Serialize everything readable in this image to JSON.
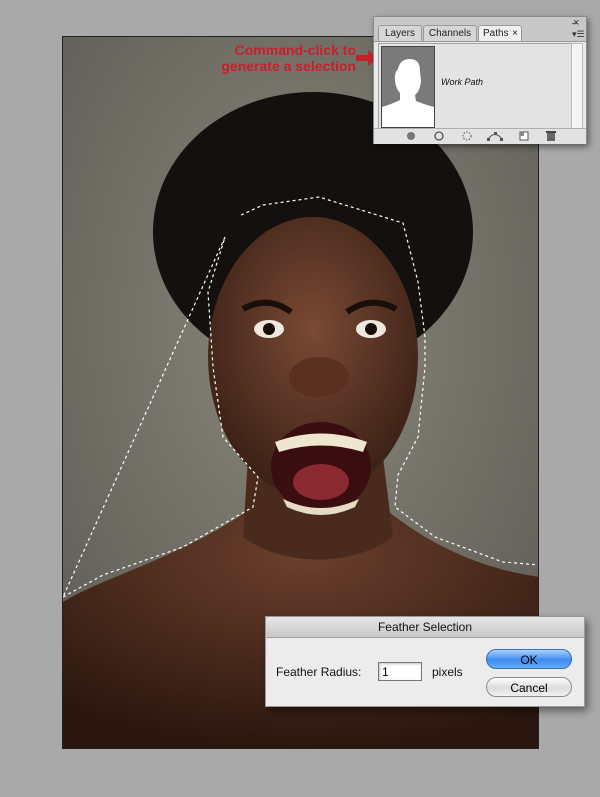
{
  "panel": {
    "tabs": [
      "Layers",
      "Channels",
      "Paths"
    ],
    "active_tab": "Paths",
    "path_name": "Work Path",
    "bottom_icons": [
      "fill-path-icon",
      "stroke-path-icon",
      "load-selection-icon",
      "make-work-path-icon",
      "new-path-icon",
      "trash-icon"
    ]
  },
  "annotation": {
    "line1": "Command-click to",
    "line2": "generate a selection",
    "color": "#c8202b"
  },
  "dialog": {
    "title": "Feather Selection",
    "label": "Feather Radius:",
    "value": "1",
    "unit": "pixels",
    "ok": "OK",
    "cancel": "Cancel"
  }
}
